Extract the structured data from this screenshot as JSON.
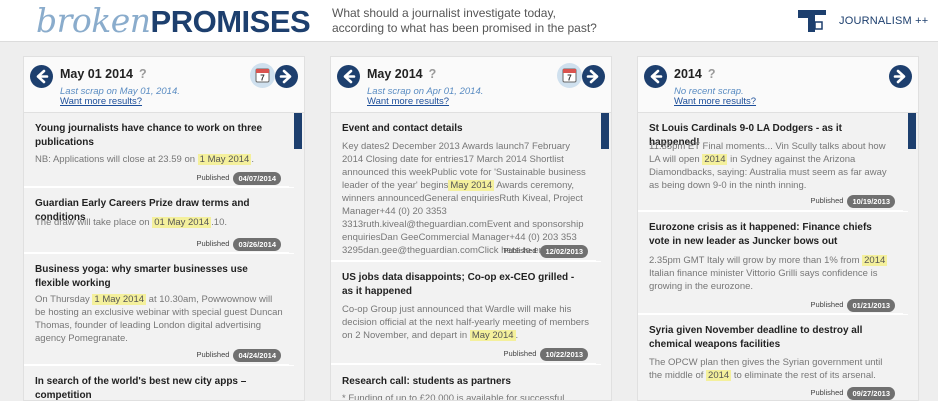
{
  "header": {
    "logo_part1": "broken",
    "logo_part2": "PROMISES",
    "tagline_line1": "What should a journalist investigate today,",
    "tagline_line2": "according to what has been promised in the past?",
    "brand_label": "JOURNALISM ++"
  },
  "common": {
    "more_results": "Want more results?",
    "published_label": "Published",
    "help_mark": "?",
    "calendar_day": "7"
  },
  "columns": [
    {
      "title": "May 01 2014",
      "last_scrap": "Last scrap on May 01, 2014.",
      "items": [
        {
          "title": "Young journalists have chance to work on three publications",
          "text_before": "NB: Applications will close at 23.59 on ",
          "highlight": "1 May 2014",
          "text_after": ".",
          "date": "04/07/2014"
        },
        {
          "title": "Guardian Early Careers Prize draw terms and conditions",
          "text_before": "The draw will take place on ",
          "highlight": "01 May 2014",
          "text_after": ".10.",
          "date": "03/26/2014"
        },
        {
          "title": "Business yoga: why smarter businesses use flexible working",
          "text_before": "On Thursday ",
          "highlight": "1 May 2014",
          "text_after": " at 10.30am, Powwownow will be hosting an exclusive webinar with special guest Duncan Thomas, founder of leading London digital advertising agency Pomegranate.",
          "date": "04/24/2014"
        },
        {
          "title": "In search of the world's best new city apps – competition",
          "text_before": "",
          "highlight": "",
          "text_after": "",
          "date": ""
        }
      ]
    },
    {
      "title": "May 2014",
      "last_scrap": "Last scrap on Apr 01, 2014.",
      "items": [
        {
          "title": "Event and contact details",
          "text_before": "Key dates2 December 2013 Awards launch7 February 2014 Closing date for entries17 March 2014 Shortlist announced this weekPublic vote for 'Sustainable business leader of the year' begins",
          "highlight": "May 2014",
          "text_after": " Awards ceremony, winners announcedGeneral enquiriesRuth Kiveal, Project Manager+44 (0) 20 3353 3313ruth.kiveal@theguardian.comEvent and sponsorship enquiriesDan GeeCommercial Manager+44 (0) 203 353 3295dan.gee@theguardian.comClick here to enter",
          "date": "12/02/2013"
        },
        {
          "title": "US jobs data disappoints; Co-op ex-CEO grilled - as it happened",
          "text_before": "Co-op Group just announced that Wardle will make his decision official at the next half-yearly meeting of members on 2 November, and depart in ",
          "highlight": "May 2014",
          "text_after": ".",
          "date": "10/22/2013"
        },
        {
          "title": "Research call: students as partners",
          "text_before": "* Funding of up to £20,000 is available for successful",
          "highlight": "",
          "text_after": "",
          "date": ""
        }
      ]
    },
    {
      "title": "2014",
      "last_scrap": "No recent scrap.",
      "items": [
        {
          "title": "St Louis Cardinals 9-0 LA Dodgers - as it happened!",
          "text_before": "11.35pm ET Final moments... Vin Scully talks about how LA will open ",
          "highlight": "2014",
          "text_after": " in Sydney against the Arizona Diamondbacks, saying: Australia must seem as far away as being down 9-0 in the ninth inning.",
          "date": "10/19/2013"
        },
        {
          "title": "Eurozone crisis as it happened: Finance chiefs vote in new leader as Juncker bows out",
          "text_before": "2.35pm GMT Italy will grow by more than 1% from ",
          "highlight": "2014",
          "text_after": " Italian finance minister Vittorio Grilli says confidence is growing in the eurozone.",
          "date": "01/21/2013"
        },
        {
          "title": "Syria given November deadline to destroy all chemical weapons facilities",
          "text_before": "The OPCW plan then gives the Syrian government until the middle of ",
          "highlight": "2014",
          "text_after": " to eliminate the rest of its arsenal.",
          "date": "09/27/2013"
        }
      ]
    }
  ],
  "colors": {
    "navy": "#1d3f6e",
    "light_blue": "#8aaccc",
    "highlight": "#f4f09c",
    "badge": "#707070"
  }
}
